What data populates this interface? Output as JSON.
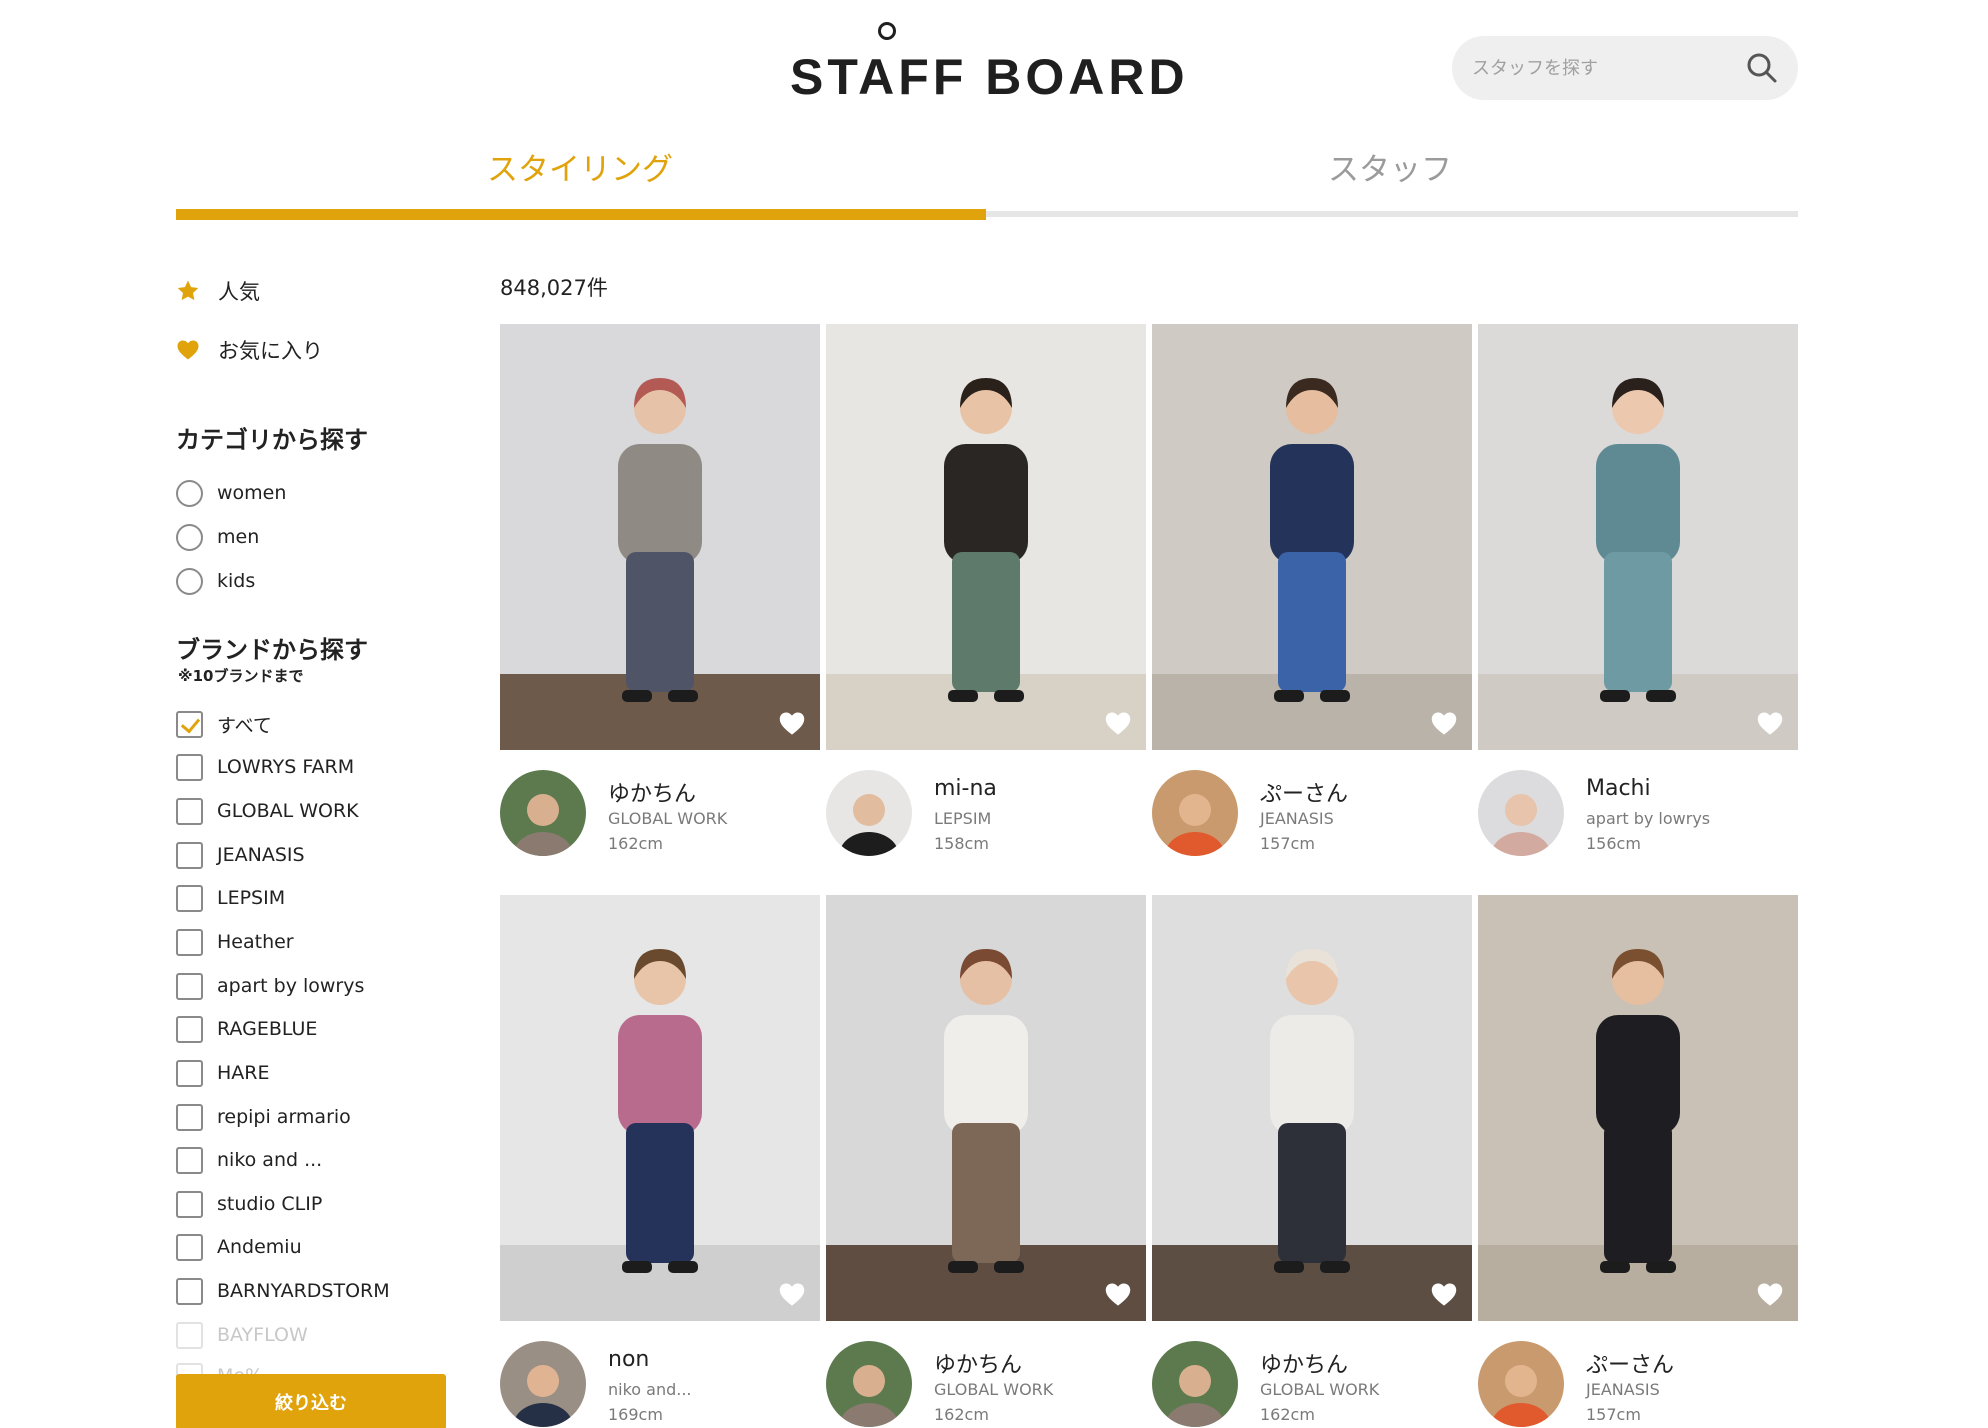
{
  "header": {
    "logo": "STAFF BOARD",
    "search_placeholder": "スタッフを探す"
  },
  "tabs": [
    {
      "label": "スタイリング",
      "active": true
    },
    {
      "label": "スタッフ",
      "active": false
    }
  ],
  "colors": {
    "accent": "#e0a30c",
    "inactive_tab": "#9b9b9b"
  },
  "sidebar": {
    "links": [
      {
        "label": "人気",
        "icon": "star-icon"
      },
      {
        "label": "お気に入り",
        "icon": "heart-icon"
      }
    ],
    "category": {
      "heading": "カテゴリから探す",
      "options": [
        "women",
        "men",
        "kids"
      ]
    },
    "brand": {
      "heading": "ブランドから探す",
      "note": "※10ブランドまで",
      "options": [
        {
          "label": "すべて",
          "checked": true
        },
        {
          "label": "LOWRYS FARM",
          "checked": false
        },
        {
          "label": "GLOBAL WORK",
          "checked": false
        },
        {
          "label": "JEANASIS",
          "checked": false
        },
        {
          "label": "LEPSIM",
          "checked": false
        },
        {
          "label": "Heather",
          "checked": false
        },
        {
          "label": "apart by lowrys",
          "checked": false
        },
        {
          "label": "RAGEBLUE",
          "checked": false
        },
        {
          "label": "HARE",
          "checked": false
        },
        {
          "label": "repipi armario",
          "checked": false
        },
        {
          "label": "niko and ...",
          "checked": false
        },
        {
          "label": "studio CLIP",
          "checked": false
        },
        {
          "label": "Andemiu",
          "checked": false
        },
        {
          "label": "BARNYARDSTORM",
          "checked": false
        },
        {
          "label": "BAYFLOW",
          "checked": false
        },
        {
          "label": "Me%",
          "checked": false
        }
      ]
    },
    "filter_button": "絞り込む"
  },
  "main": {
    "result_count": "848,027件",
    "cards": [
      {
        "name": "ゆかちん",
        "brand": "GLOBAL WORK",
        "height": "162cm"
      },
      {
        "name": "mi-na",
        "brand": "LEPSIM",
        "height": "158cm"
      },
      {
        "name": "ぷーさん",
        "brand": "JEANASIS",
        "height": "157cm"
      },
      {
        "name": "Machi",
        "brand": "apart by lowrys",
        "height": "156cm"
      },
      {
        "name": "non",
        "brand": "niko and...",
        "height": "169cm"
      },
      {
        "name": "ゆかちん",
        "brand": "GLOBAL WORK",
        "height": "162cm"
      },
      {
        "name": "ゆかちん",
        "brand": "GLOBAL WORK",
        "height": "162cm"
      },
      {
        "name": "ぷーさん",
        "brand": "JEANASIS",
        "height": "157cm"
      }
    ]
  }
}
